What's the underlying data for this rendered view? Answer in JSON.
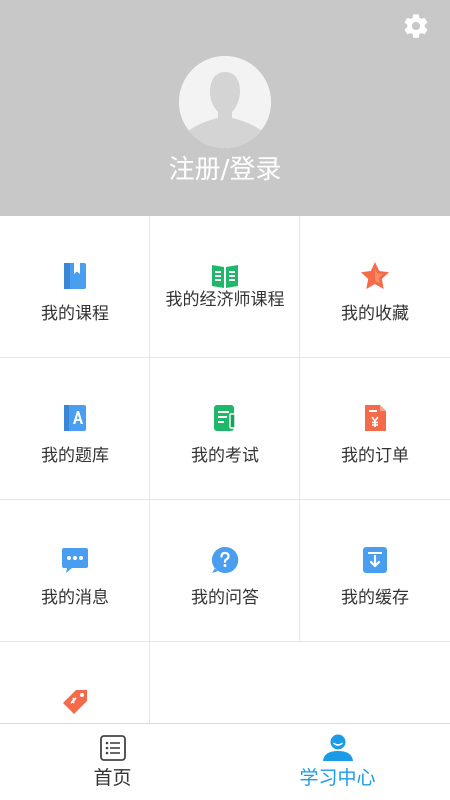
{
  "header": {
    "login_label": "注册/登录",
    "avatar_icon": "avatar-placeholder-icon",
    "settings_icon": "gear-icon"
  },
  "menu": {
    "items": [
      {
        "label": "我的课程",
        "icon": "book-bookmark-icon",
        "color": "#4a9ef0"
      },
      {
        "label": "我的经济师课程",
        "icon": "open-book-icon",
        "color": "#1fb86a"
      },
      {
        "label": "我的收藏",
        "icon": "star-icon",
        "color": "#f46a4a"
      },
      {
        "label": "我的题库",
        "icon": "question-bank-icon",
        "color": "#4a9ef0"
      },
      {
        "label": "我的考试",
        "icon": "exam-paper-icon",
        "color": "#1fb86a"
      },
      {
        "label": "我的订单",
        "icon": "order-receipt-icon",
        "color": "#f46a4a"
      },
      {
        "label": "我的消息",
        "icon": "message-bubble-icon",
        "color": "#4a9ef0"
      },
      {
        "label": "我的问答",
        "icon": "question-icon",
        "color": "#4a9ef0"
      },
      {
        "label": "我的缓存",
        "icon": "download-icon",
        "color": "#4a9ef0"
      },
      {
        "label": "",
        "icon": "coupon-tag-icon",
        "color": "#f46a4a"
      }
    ]
  },
  "tabbar": {
    "tabs": [
      {
        "label": "首页",
        "icon": "home-list-icon",
        "active": false,
        "color": "#333333"
      },
      {
        "label": "学习中心",
        "icon": "user-center-icon",
        "active": true,
        "color": "#1a9be8"
      }
    ]
  }
}
